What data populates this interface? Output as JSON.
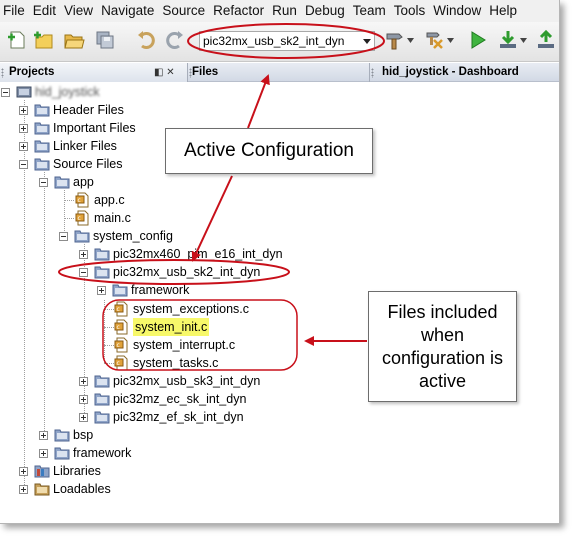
{
  "menu": [
    "File",
    "Edit",
    "View",
    "Navigate",
    "Source",
    "Refactor",
    "Run",
    "Debug",
    "Team",
    "Tools",
    "Window",
    "Help"
  ],
  "toolbar": {
    "configuration": "pic32mx_usb_sk2_int_dyn",
    "icons": [
      "new-file-icon",
      "new-project-icon",
      "open-project-icon",
      "save-all-icon",
      "undo-icon",
      "redo-icon",
      "build-hammer-icon",
      "clean-build-icon",
      "run-icon",
      "program-device-icon",
      "upload-icon"
    ]
  },
  "panel": {
    "projects_tab": "Projects",
    "projects_ctrl": "◧ ✕",
    "files_tab": "Files",
    "dashboard_tab": "hid_joystick - Dashboard"
  },
  "tree": {
    "project_name": "hid_joystick",
    "header_files": "Header Files",
    "important_files": "Important Files",
    "linker_files": "Linker Files",
    "source_files": "Source Files",
    "app": "app",
    "app_c": "app.c",
    "main_c": "main.c",
    "system_config": "system_config",
    "pic32mx460": "pic32mx460_pim_e16_int_dyn",
    "pic32mx_usb_sk2": "pic32mx_usb_sk2_int_dyn",
    "framework": "framework",
    "system_exceptions": "system_exceptions.c",
    "system_init": "system_init.c",
    "system_interrupt": "system_interrupt.c",
    "system_tasks": "system_tasks.c",
    "pic32mx_usb_sk3": "pic32mx_usb_sk3_int_dyn",
    "pic32mz_ec_sk": "pic32mz_ec_sk_int_dyn",
    "pic32mz_ef_sk": "pic32mz_ef_sk_int_dyn",
    "bsp": "bsp",
    "framework2": "framework",
    "libraries": "Libraries",
    "loadables": "Loadables"
  },
  "annotations": {
    "active_configuration": "Active Configuration",
    "files_included_1": "Files included",
    "files_included_2": "when",
    "files_included_3": "configuration is",
    "files_included_4": "active"
  },
  "colors": {
    "annotation_red": "#c8101a",
    "highlight_yellow": "#f7f86a",
    "folder_blue": "#6f88b5",
    "source_file_orange": "#e0a23a"
  }
}
